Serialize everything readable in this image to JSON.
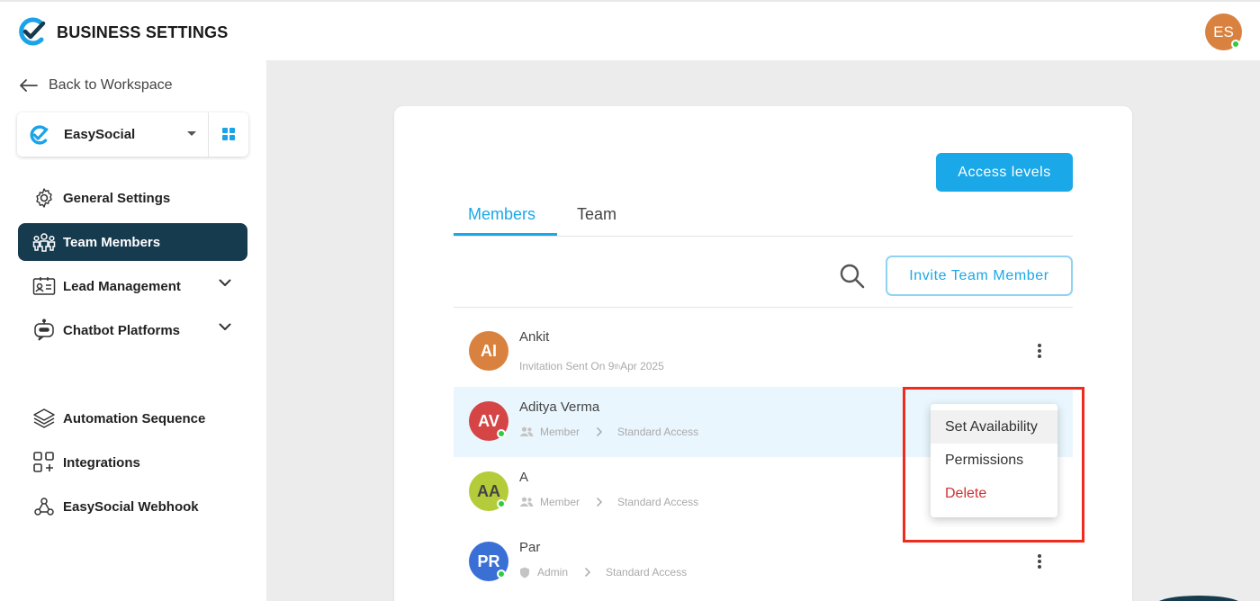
{
  "header": {
    "title": "BUSINESS SETTINGS",
    "user_initials": "ES",
    "user_avatar_color": "#d9823f"
  },
  "sidebar": {
    "back_label": "Back to Workspace",
    "workspace": {
      "name": "EasySocial"
    },
    "items": [
      {
        "label": "General Settings",
        "icon": "gear-icon"
      },
      {
        "label": "Team Members",
        "icon": "team-icon",
        "active": true
      },
      {
        "label": "Lead Management",
        "icon": "contact-card-icon",
        "expandable": true
      },
      {
        "label": "Chatbot Platforms",
        "icon": "chatbot-icon",
        "expandable": true
      },
      {
        "label": "Automation Sequence",
        "icon": "layers-icon"
      },
      {
        "label": "Integrations",
        "icon": "integrations-icon"
      },
      {
        "label": "EasySocial Webhook",
        "icon": "webhook-icon"
      }
    ]
  },
  "main": {
    "access_levels_label": "Access levels",
    "tabs": [
      {
        "label": "Members",
        "active": true
      },
      {
        "label": "Team"
      }
    ],
    "invite_label": "Invite Team Member",
    "members": [
      {
        "initials": "AI",
        "name": "Ankit",
        "status_prefix": "Invitation Sent On 9",
        "status_sup": "th",
        "status_suffix": " Apr 2025",
        "color": "#d9823f"
      },
      {
        "initials": "AV",
        "name": "Aditya Verma",
        "role": "Member",
        "access": "Standard Access",
        "color": "#d64545"
      },
      {
        "initials": "AA",
        "name": "A",
        "role": "Member",
        "access": "Standard Access",
        "color": "#b5cc3a"
      },
      {
        "initials": "PR",
        "name": "Par",
        "role": "Admin",
        "access": "Standard Access",
        "color": "#3a6fd6"
      }
    ],
    "context_menu": [
      "Set Availability",
      "Permissions",
      "Delete"
    ]
  },
  "colors": {
    "accent": "#1aa8e8",
    "sidebar_active": "#163a4e",
    "danger": "#d32f2f",
    "highlight": "#ee2b1c"
  }
}
